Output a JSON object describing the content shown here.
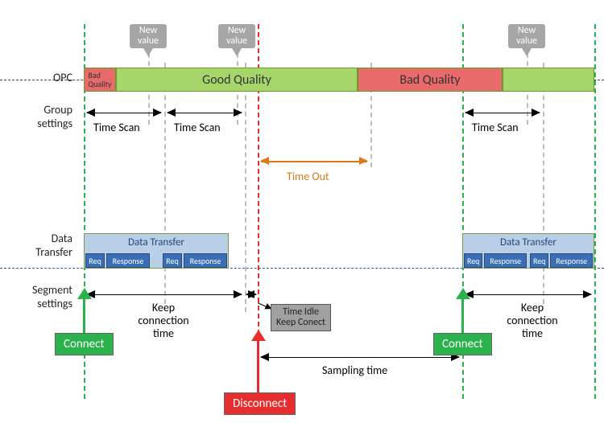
{
  "rows": {
    "opc": "OPC",
    "group": "Group\nsettings",
    "data": "Data\nTransfer",
    "segment": "Segment\nsettings"
  },
  "callouts": {
    "new_value": "New\nvalue"
  },
  "opc_segments": {
    "bad1": "Bad\nQuality",
    "good": "Good Quality",
    "bad2": "Bad Quality",
    "good2": ""
  },
  "spans": {
    "time_scan": "Time Scan",
    "time_out": "Time Out",
    "keep_conn": "Keep\nconnection\ntime",
    "sampling": "Sampling time"
  },
  "idle_box": "Time Idle\nKeep Conect",
  "dt": {
    "title": "Data Transfer",
    "req": "Req",
    "resp": "Response"
  },
  "badges": {
    "connect": "Connect",
    "disconnect": "Disconnect"
  },
  "chart_data": {
    "type": "timeline",
    "axis": "time (relative units 0–640)",
    "guides": {
      "connect_1": 6,
      "scan_end_1": 106,
      "new_value_1": 86,
      "scan_end_2": 206,
      "new_value_2": 196,
      "disconnect": 222,
      "idle_start": 206,
      "idle_end": 222,
      "timeout_end": 362,
      "connect_2": 476,
      "new_value_3": 556,
      "scan_end_3": 576,
      "right_edge": 640
    },
    "opc_quality": [
      {
        "from": 6,
        "to": 46,
        "state": "Bad Quality"
      },
      {
        "from": 46,
        "to": 346,
        "state": "Good Quality"
      },
      {
        "from": 346,
        "to": 526,
        "state": "Bad Quality"
      },
      {
        "from": 526,
        "to": 640,
        "state": "Good Quality"
      }
    ],
    "group_time_scan": [
      {
        "from": 6,
        "to": 106
      },
      {
        "from": 106,
        "to": 206
      },
      {
        "from": 476,
        "to": 576
      }
    ],
    "time_out": {
      "from": 222,
      "to": 362
    },
    "data_transfer_sessions": [
      {
        "from": 6,
        "to": 186,
        "sequence": [
          "Req",
          "Response",
          "Req",
          "Response"
        ]
      },
      {
        "from": 476,
        "to": 640,
        "sequence": [
          "Req",
          "Response",
          "Req",
          "Response"
        ]
      }
    ],
    "segment_keep_connection": [
      {
        "from": 6,
        "to": 206
      },
      {
        "from": 476,
        "to": 640
      }
    ],
    "sampling_time": {
      "from": 222,
      "to": 476
    },
    "events": [
      {
        "t": 6,
        "event": "Connect"
      },
      {
        "t": 222,
        "event": "Disconnect"
      },
      {
        "t": 476,
        "event": "Connect"
      }
    ]
  }
}
